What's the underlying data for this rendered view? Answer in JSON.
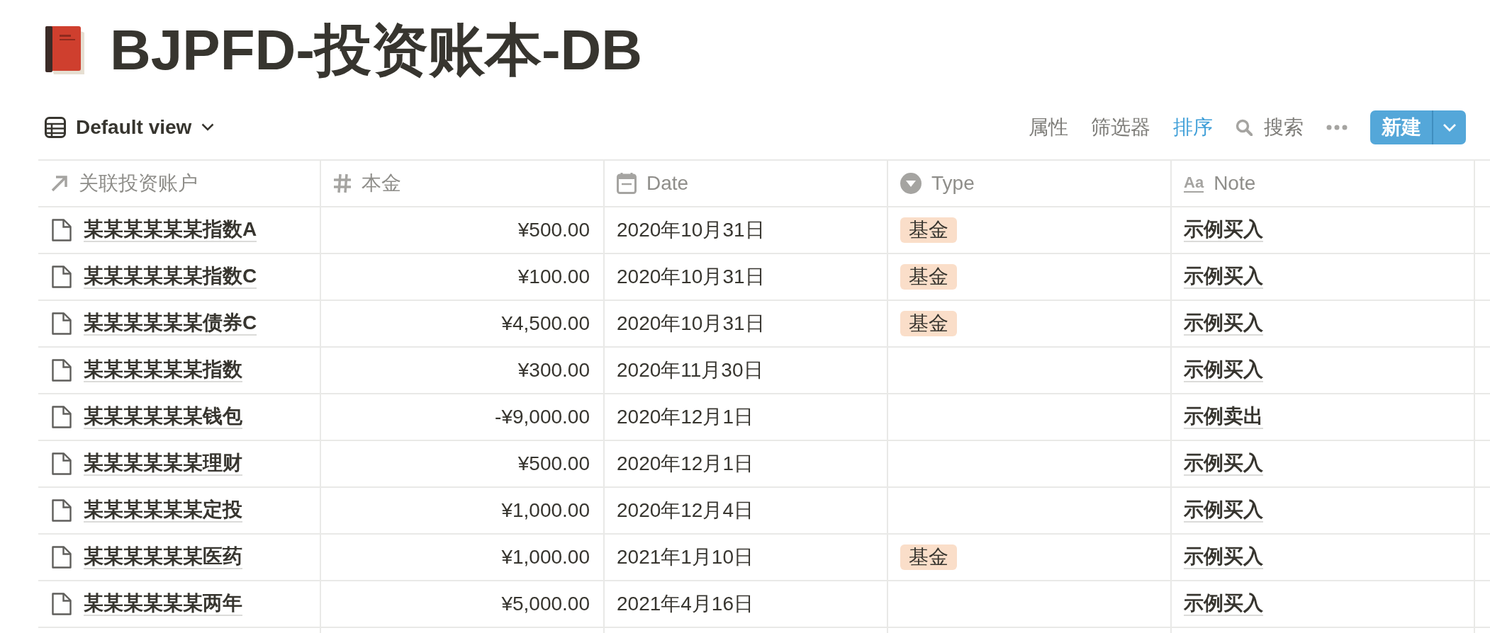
{
  "page_title": "BJPFD-投资账本-DB",
  "toolbar": {
    "view_label": "Default view",
    "actions": [
      {
        "label": "属性",
        "active": false
      },
      {
        "label": "筛选器",
        "active": false
      },
      {
        "label": "排序",
        "active": true
      }
    ],
    "search": {
      "label": "搜索"
    },
    "new_button": {
      "label": "新建"
    }
  },
  "table": {
    "columns": [
      {
        "label": "关联投资账户",
        "kind": "relation"
      },
      {
        "label": "本金",
        "kind": "number"
      },
      {
        "label": "Date",
        "kind": "date"
      },
      {
        "label": "Type",
        "kind": "select"
      },
      {
        "label": "Note",
        "kind": "text",
        "icon_glyph": "Aa"
      }
    ],
    "rows": [
      {
        "name": "某某某某某某指数A",
        "amount": "¥500.00",
        "date": "2020年10月31日",
        "type": "基金",
        "note": "示例买入"
      },
      {
        "name": "某某某某某某指数C",
        "amount": "¥100.00",
        "date": "2020年10月31日",
        "type": "基金",
        "note": "示例买入"
      },
      {
        "name": "某某某某某某债券C",
        "amount": "¥4,500.00",
        "date": "2020年10月31日",
        "type": "基金",
        "note": "示例买入"
      },
      {
        "name": "某某某某某某指数",
        "amount": "¥300.00",
        "date": "2020年11月30日",
        "note": "示例买入"
      },
      {
        "name": "某某某某某某钱包",
        "amount": "-¥9,000.00",
        "date": "2020年12月1日",
        "note": "示例卖出"
      },
      {
        "name": "某某某某某某理财",
        "amount": "¥500.00",
        "date": "2020年12月1日",
        "note": "示例买入"
      },
      {
        "name": "某某某某某某定投",
        "amount": "¥1,000.00",
        "date": "2020年12月4日",
        "note": "示例买入"
      },
      {
        "name": "某某某某某某医药",
        "amount": "¥1,000.00",
        "date": "2021年1月10日",
        "type": "基金",
        "note": "示例买入"
      },
      {
        "name": "某某某某某某两年",
        "amount": "¥5,000.00",
        "date": "2021年4月16日",
        "note": "示例买入"
      }
    ]
  }
}
